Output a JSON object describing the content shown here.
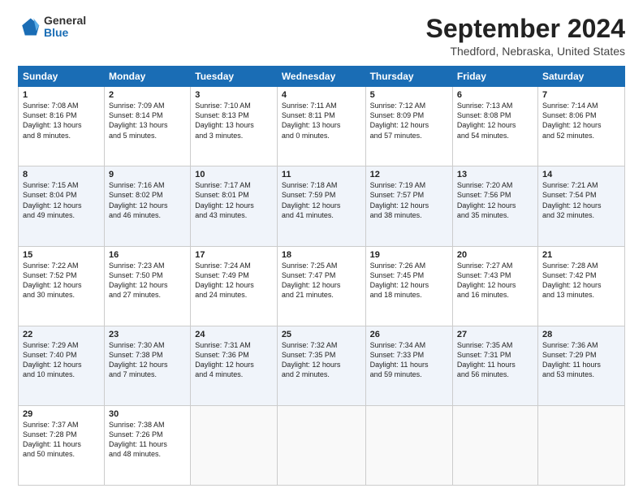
{
  "logo": {
    "general": "General",
    "blue": "Blue"
  },
  "title": "September 2024",
  "subtitle": "Thedford, Nebraska, United States",
  "header": {
    "days": [
      "Sunday",
      "Monday",
      "Tuesday",
      "Wednesday",
      "Thursday",
      "Friday",
      "Saturday"
    ]
  },
  "weeks": [
    [
      {
        "day": "1",
        "info": "Sunrise: 7:08 AM\nSunset: 8:16 PM\nDaylight: 13 hours\nand 8 minutes."
      },
      {
        "day": "2",
        "info": "Sunrise: 7:09 AM\nSunset: 8:14 PM\nDaylight: 13 hours\nand 5 minutes."
      },
      {
        "day": "3",
        "info": "Sunrise: 7:10 AM\nSunset: 8:13 PM\nDaylight: 13 hours\nand 3 minutes."
      },
      {
        "day": "4",
        "info": "Sunrise: 7:11 AM\nSunset: 8:11 PM\nDaylight: 13 hours\nand 0 minutes."
      },
      {
        "day": "5",
        "info": "Sunrise: 7:12 AM\nSunset: 8:09 PM\nDaylight: 12 hours\nand 57 minutes."
      },
      {
        "day": "6",
        "info": "Sunrise: 7:13 AM\nSunset: 8:08 PM\nDaylight: 12 hours\nand 54 minutes."
      },
      {
        "day": "7",
        "info": "Sunrise: 7:14 AM\nSunset: 8:06 PM\nDaylight: 12 hours\nand 52 minutes."
      }
    ],
    [
      {
        "day": "8",
        "info": "Sunrise: 7:15 AM\nSunset: 8:04 PM\nDaylight: 12 hours\nand 49 minutes."
      },
      {
        "day": "9",
        "info": "Sunrise: 7:16 AM\nSunset: 8:02 PM\nDaylight: 12 hours\nand 46 minutes."
      },
      {
        "day": "10",
        "info": "Sunrise: 7:17 AM\nSunset: 8:01 PM\nDaylight: 12 hours\nand 43 minutes."
      },
      {
        "day": "11",
        "info": "Sunrise: 7:18 AM\nSunset: 7:59 PM\nDaylight: 12 hours\nand 41 minutes."
      },
      {
        "day": "12",
        "info": "Sunrise: 7:19 AM\nSunset: 7:57 PM\nDaylight: 12 hours\nand 38 minutes."
      },
      {
        "day": "13",
        "info": "Sunrise: 7:20 AM\nSunset: 7:56 PM\nDaylight: 12 hours\nand 35 minutes."
      },
      {
        "day": "14",
        "info": "Sunrise: 7:21 AM\nSunset: 7:54 PM\nDaylight: 12 hours\nand 32 minutes."
      }
    ],
    [
      {
        "day": "15",
        "info": "Sunrise: 7:22 AM\nSunset: 7:52 PM\nDaylight: 12 hours\nand 30 minutes."
      },
      {
        "day": "16",
        "info": "Sunrise: 7:23 AM\nSunset: 7:50 PM\nDaylight: 12 hours\nand 27 minutes."
      },
      {
        "day": "17",
        "info": "Sunrise: 7:24 AM\nSunset: 7:49 PM\nDaylight: 12 hours\nand 24 minutes."
      },
      {
        "day": "18",
        "info": "Sunrise: 7:25 AM\nSunset: 7:47 PM\nDaylight: 12 hours\nand 21 minutes."
      },
      {
        "day": "19",
        "info": "Sunrise: 7:26 AM\nSunset: 7:45 PM\nDaylight: 12 hours\nand 18 minutes."
      },
      {
        "day": "20",
        "info": "Sunrise: 7:27 AM\nSunset: 7:43 PM\nDaylight: 12 hours\nand 16 minutes."
      },
      {
        "day": "21",
        "info": "Sunrise: 7:28 AM\nSunset: 7:42 PM\nDaylight: 12 hours\nand 13 minutes."
      }
    ],
    [
      {
        "day": "22",
        "info": "Sunrise: 7:29 AM\nSunset: 7:40 PM\nDaylight: 12 hours\nand 10 minutes."
      },
      {
        "day": "23",
        "info": "Sunrise: 7:30 AM\nSunset: 7:38 PM\nDaylight: 12 hours\nand 7 minutes."
      },
      {
        "day": "24",
        "info": "Sunrise: 7:31 AM\nSunset: 7:36 PM\nDaylight: 12 hours\nand 4 minutes."
      },
      {
        "day": "25",
        "info": "Sunrise: 7:32 AM\nSunset: 7:35 PM\nDaylight: 12 hours\nand 2 minutes."
      },
      {
        "day": "26",
        "info": "Sunrise: 7:34 AM\nSunset: 7:33 PM\nDaylight: 11 hours\nand 59 minutes."
      },
      {
        "day": "27",
        "info": "Sunrise: 7:35 AM\nSunset: 7:31 PM\nDaylight: 11 hours\nand 56 minutes."
      },
      {
        "day": "28",
        "info": "Sunrise: 7:36 AM\nSunset: 7:29 PM\nDaylight: 11 hours\nand 53 minutes."
      }
    ],
    [
      {
        "day": "29",
        "info": "Sunrise: 7:37 AM\nSunset: 7:28 PM\nDaylight: 11 hours\nand 50 minutes."
      },
      {
        "day": "30",
        "info": "Sunrise: 7:38 AM\nSunset: 7:26 PM\nDaylight: 11 hours\nand 48 minutes."
      },
      {
        "day": "",
        "info": ""
      },
      {
        "day": "",
        "info": ""
      },
      {
        "day": "",
        "info": ""
      },
      {
        "day": "",
        "info": ""
      },
      {
        "day": "",
        "info": ""
      }
    ]
  ]
}
